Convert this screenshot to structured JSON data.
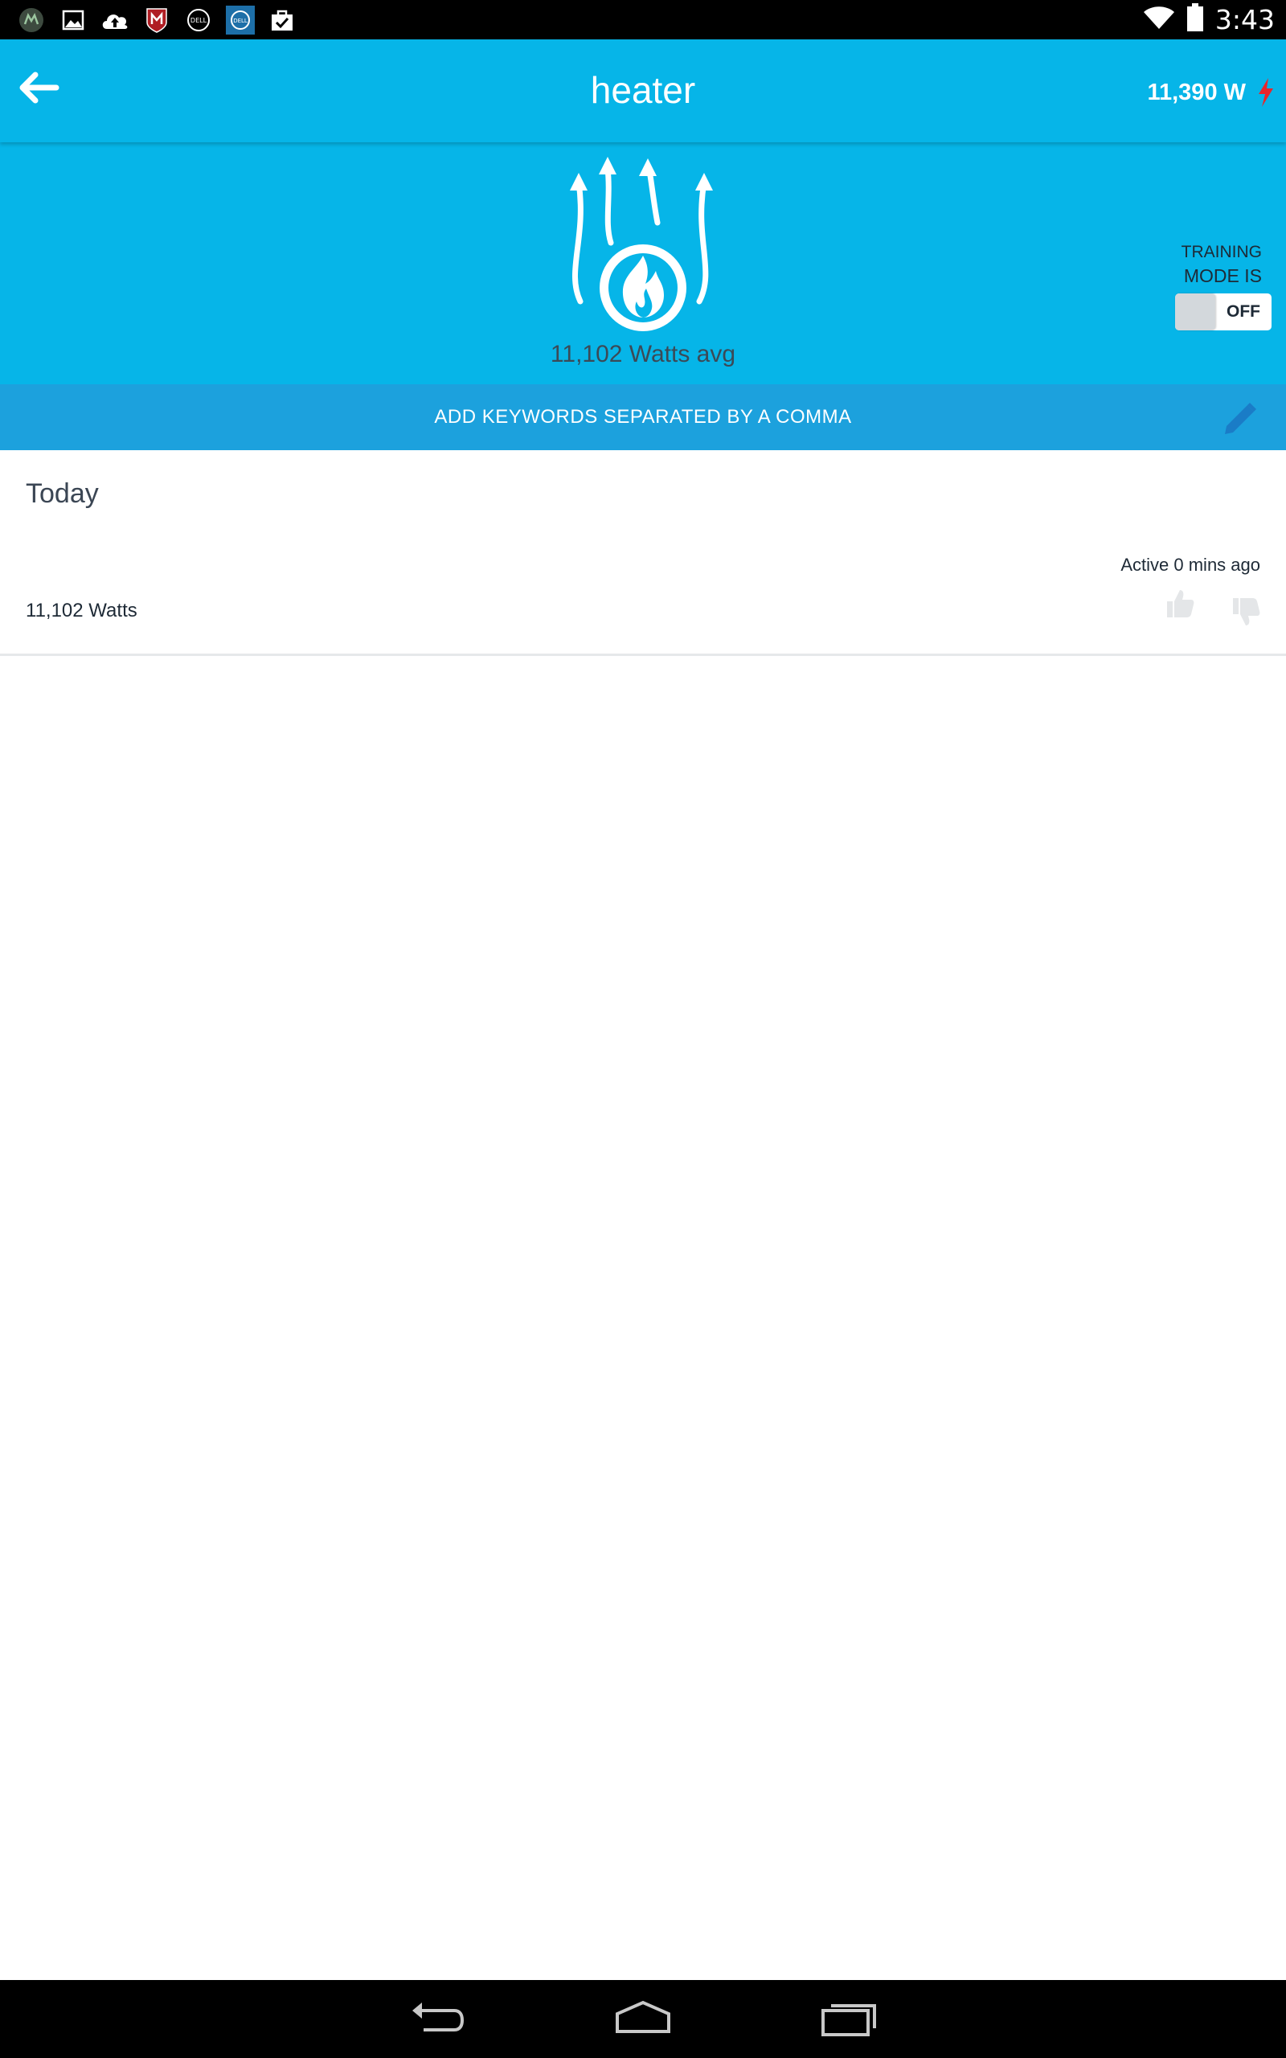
{
  "status_bar": {
    "time": "3:43",
    "notification_icons": [
      "app-icon",
      "gallery-icon",
      "cloud-upload-icon",
      "mcafee-icon",
      "dell-icon",
      "dell-app-icon",
      "shopping-bag-icon"
    ],
    "system_icons": [
      "wifi-icon",
      "battery-icon"
    ]
  },
  "app_bar": {
    "title": "heater",
    "power_reading": "11,390 W"
  },
  "hero": {
    "device_icon": "heater-flame-icon",
    "avg_label": "11,102 Watts avg",
    "training_line1": "TRAINING",
    "training_line2": "MODE IS",
    "toggle_state": "OFF"
  },
  "keywords_bar": {
    "placeholder": "ADD KEYWORDS SEPARATED BY A COMMA"
  },
  "today_section": {
    "heading": "Today",
    "active_status": "Active 0 mins ago",
    "watts": "11,102 Watts"
  },
  "colors": {
    "accent": "#06b5e8",
    "keywords_bar": "#1ca1dd",
    "bolt": "#e8262c",
    "edit_icon": "#1a7cc7"
  }
}
